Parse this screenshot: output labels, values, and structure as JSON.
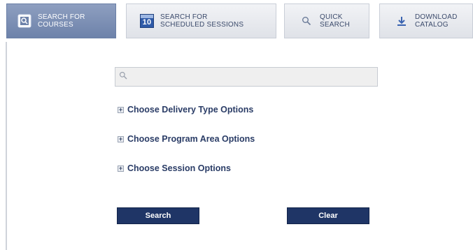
{
  "tabs": [
    {
      "line1": "Search for",
      "line2": "Courses",
      "icon": "course-search-icon"
    },
    {
      "line1": "Search for",
      "line2": "Scheduled Sessions",
      "icon": "calendar-icon",
      "icon_text": "10"
    },
    {
      "line1": "Quick",
      "line2": "Search",
      "icon": "magnifier-icon"
    },
    {
      "line1": "Download",
      "line2": "Catalog",
      "icon": "download-icon"
    }
  ],
  "search": {
    "placeholder": "",
    "value": ""
  },
  "options": [
    {
      "label": "Choose Delivery Type Options",
      "toggle": "+"
    },
    {
      "label": "Choose Program Area Options",
      "toggle": "+"
    },
    {
      "label": "Choose Session Options",
      "toggle": "+"
    }
  ],
  "buttons": {
    "search_label": "Search",
    "clear_label": "Clear"
  },
  "colors": {
    "active_tab": "#7a8db3",
    "button_bg": "#1f3566",
    "option_text": "#2a3c66"
  }
}
